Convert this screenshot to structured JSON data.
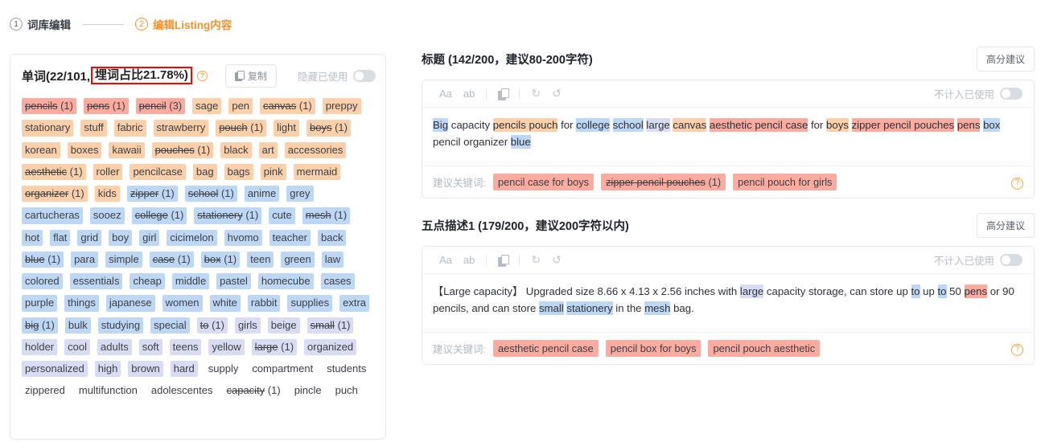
{
  "breadcrumb": {
    "steps": [
      {
        "num": "1",
        "label": "词库编辑",
        "active": false
      },
      {
        "num": "2",
        "label": "编辑Listing内容",
        "active": true
      }
    ]
  },
  "left_panel": {
    "title_prefix": "单词(22/101,",
    "title_boxed": "埋词占比21.78%)",
    "help_icon": "question-circle-icon",
    "copy_label": "复制",
    "copy_icon": "copy-icon",
    "hide_used_label": "隐藏已使用",
    "hide_used_on": false,
    "tags": [
      {
        "w": "pencils",
        "cnt": "(1)",
        "color": "red",
        "used": true
      },
      {
        "w": "pens",
        "cnt": "(1)",
        "color": "red",
        "used": true
      },
      {
        "w": "pencil",
        "cnt": "(3)",
        "color": "red",
        "used": true
      },
      {
        "w": "sage",
        "cnt": "",
        "color": "orange",
        "used": false
      },
      {
        "w": "pen",
        "cnt": "",
        "color": "orange",
        "used": false
      },
      {
        "w": "canvas",
        "cnt": "(1)",
        "color": "orange",
        "used": true
      },
      {
        "w": "preppy",
        "cnt": "",
        "color": "orange",
        "used": false
      },
      {
        "w": "stationary",
        "cnt": "",
        "color": "orange",
        "used": false
      },
      {
        "w": "stuff",
        "cnt": "",
        "color": "orange",
        "used": false
      },
      {
        "w": "fabric",
        "cnt": "",
        "color": "orange",
        "used": false
      },
      {
        "w": "strawberry",
        "cnt": "",
        "color": "orange",
        "used": false
      },
      {
        "w": "pouch",
        "cnt": "(1)",
        "color": "orange",
        "used": true
      },
      {
        "w": "light",
        "cnt": "",
        "color": "orange",
        "used": false
      },
      {
        "w": "boys",
        "cnt": "(1)",
        "color": "orange",
        "used": true
      },
      {
        "w": "korean",
        "cnt": "",
        "color": "orange",
        "used": false
      },
      {
        "w": "boxes",
        "cnt": "",
        "color": "orange",
        "used": false
      },
      {
        "w": "kawaii",
        "cnt": "",
        "color": "orange",
        "used": false
      },
      {
        "w": "pouches",
        "cnt": "(1)",
        "color": "orange",
        "used": true
      },
      {
        "w": "black",
        "cnt": "",
        "color": "orange",
        "used": false
      },
      {
        "w": "art",
        "cnt": "",
        "color": "orange",
        "used": false
      },
      {
        "w": "accessories",
        "cnt": "",
        "color": "orange",
        "used": false
      },
      {
        "w": "aesthetic",
        "cnt": "(1)",
        "color": "orange",
        "used": true
      },
      {
        "w": "roller",
        "cnt": "",
        "color": "orange",
        "used": false
      },
      {
        "w": "pencilcase",
        "cnt": "",
        "color": "orange",
        "used": false
      },
      {
        "w": "bag",
        "cnt": "",
        "color": "orange",
        "used": false
      },
      {
        "w": "bags",
        "cnt": "",
        "color": "orange",
        "used": false
      },
      {
        "w": "pink",
        "cnt": "",
        "color": "orange",
        "used": false
      },
      {
        "w": "mermaid",
        "cnt": "",
        "color": "orange",
        "used": false
      },
      {
        "w": "organizer",
        "cnt": "(1)",
        "color": "orange",
        "used": true
      },
      {
        "w": "kids",
        "cnt": "",
        "color": "orange",
        "used": false
      },
      {
        "w": "zipper",
        "cnt": "(1)",
        "color": "blue",
        "used": true
      },
      {
        "w": "school",
        "cnt": "(1)",
        "color": "blue",
        "used": true
      },
      {
        "w": "anime",
        "cnt": "",
        "color": "blue",
        "used": false
      },
      {
        "w": "grey",
        "cnt": "",
        "color": "blue",
        "used": false
      },
      {
        "w": "cartucheras",
        "cnt": "",
        "color": "blue",
        "used": false
      },
      {
        "w": "sooez",
        "cnt": "",
        "color": "blue",
        "used": false
      },
      {
        "w": "college",
        "cnt": "(1)",
        "color": "blue",
        "used": true
      },
      {
        "w": "stationery",
        "cnt": "(1)",
        "color": "blue",
        "used": true
      },
      {
        "w": "cute",
        "cnt": "",
        "color": "blue",
        "used": false
      },
      {
        "w": "mesh",
        "cnt": "(1)",
        "color": "blue",
        "used": true
      },
      {
        "w": "hot",
        "cnt": "",
        "color": "blue",
        "used": false
      },
      {
        "w": "flat",
        "cnt": "",
        "color": "blue",
        "used": false
      },
      {
        "w": "grid",
        "cnt": "",
        "color": "blue",
        "used": false
      },
      {
        "w": "boy",
        "cnt": "",
        "color": "blue",
        "used": false
      },
      {
        "w": "girl",
        "cnt": "",
        "color": "blue",
        "used": false
      },
      {
        "w": "cicimelon",
        "cnt": "",
        "color": "blue",
        "used": false
      },
      {
        "w": "hvomo",
        "cnt": "",
        "color": "blue",
        "used": false
      },
      {
        "w": "teacher",
        "cnt": "",
        "color": "blue",
        "used": false
      },
      {
        "w": "back",
        "cnt": "",
        "color": "blue",
        "used": false
      },
      {
        "w": "blue",
        "cnt": "(1)",
        "color": "blue",
        "used": true
      },
      {
        "w": "para",
        "cnt": "",
        "color": "blue",
        "used": false
      },
      {
        "w": "simple",
        "cnt": "",
        "color": "blue",
        "used": false
      },
      {
        "w": "case",
        "cnt": "(1)",
        "color": "blue",
        "used": true
      },
      {
        "w": "box",
        "cnt": "(1)",
        "color": "blue",
        "used": true
      },
      {
        "w": "teen",
        "cnt": "",
        "color": "blue",
        "used": false
      },
      {
        "w": "green",
        "cnt": "",
        "color": "blue",
        "used": false
      },
      {
        "w": "law",
        "cnt": "",
        "color": "blue",
        "used": false
      },
      {
        "w": "colored",
        "cnt": "",
        "color": "blue",
        "used": false
      },
      {
        "w": "essentials",
        "cnt": "",
        "color": "blue",
        "used": false
      },
      {
        "w": "cheap",
        "cnt": "",
        "color": "blue",
        "used": false
      },
      {
        "w": "middle",
        "cnt": "",
        "color": "blue",
        "used": false
      },
      {
        "w": "pastel",
        "cnt": "",
        "color": "blue",
        "used": false
      },
      {
        "w": "homecube",
        "cnt": "",
        "color": "blue",
        "used": false
      },
      {
        "w": "cases",
        "cnt": "",
        "color": "blue",
        "used": false
      },
      {
        "w": "purple",
        "cnt": "",
        "color": "blue",
        "used": false
      },
      {
        "w": "things",
        "cnt": "",
        "color": "blue",
        "used": false
      },
      {
        "w": "japanese",
        "cnt": "",
        "color": "blue",
        "used": false
      },
      {
        "w": "women",
        "cnt": "",
        "color": "blue",
        "used": false
      },
      {
        "w": "white",
        "cnt": "",
        "color": "blue",
        "used": false
      },
      {
        "w": "rabbit",
        "cnt": "",
        "color": "blue",
        "used": false
      },
      {
        "w": "supplies",
        "cnt": "",
        "color": "blue",
        "used": false
      },
      {
        "w": "extra",
        "cnt": "",
        "color": "blue",
        "used": false
      },
      {
        "w": "big",
        "cnt": "(1)",
        "color": "blue",
        "used": true
      },
      {
        "w": "bulk",
        "cnt": "",
        "color": "blue",
        "used": false
      },
      {
        "w": "studying",
        "cnt": "",
        "color": "blue",
        "used": false
      },
      {
        "w": "special",
        "cnt": "",
        "color": "blue",
        "used": false
      },
      {
        "w": "to",
        "cnt": "(1)",
        "color": "lav",
        "used": true
      },
      {
        "w": "girls",
        "cnt": "",
        "color": "lav",
        "used": false
      },
      {
        "w": "beige",
        "cnt": "",
        "color": "lav",
        "used": false
      },
      {
        "w": "small",
        "cnt": "(1)",
        "color": "lav",
        "used": true
      },
      {
        "w": "holder",
        "cnt": "",
        "color": "lav",
        "used": false
      },
      {
        "w": "cool",
        "cnt": "",
        "color": "lav",
        "used": false
      },
      {
        "w": "adults",
        "cnt": "",
        "color": "lav",
        "used": false
      },
      {
        "w": "soft",
        "cnt": "",
        "color": "lav",
        "used": false
      },
      {
        "w": "teens",
        "cnt": "",
        "color": "lav",
        "used": false
      },
      {
        "w": "yellow",
        "cnt": "",
        "color": "lav",
        "used": false
      },
      {
        "w": "large",
        "cnt": "(1)",
        "color": "lav",
        "used": true
      },
      {
        "w": "organized",
        "cnt": "",
        "color": "lav",
        "used": false
      },
      {
        "w": "personalized",
        "cnt": "",
        "color": "lav",
        "used": false
      },
      {
        "w": "high",
        "cnt": "",
        "color": "lav",
        "used": false
      },
      {
        "w": "brown",
        "cnt": "",
        "color": "lav",
        "used": false
      },
      {
        "w": "hard",
        "cnt": "",
        "color": "lav",
        "used": false
      },
      {
        "w": "supply",
        "cnt": "",
        "color": "none",
        "used": false
      },
      {
        "w": "compartment",
        "cnt": "",
        "color": "none",
        "used": false
      },
      {
        "w": "students",
        "cnt": "",
        "color": "none",
        "used": false
      },
      {
        "w": "zippered",
        "cnt": "",
        "color": "none",
        "used": false
      },
      {
        "w": "multifunction",
        "cnt": "",
        "color": "none",
        "used": false
      },
      {
        "w": "adolescentes",
        "cnt": "",
        "color": "none",
        "used": false
      },
      {
        "w": "capacity",
        "cnt": "(1)",
        "color": "none",
        "used": true
      },
      {
        "w": "pincle",
        "cnt": "",
        "color": "none",
        "used": false
      },
      {
        "w": "puch",
        "cnt": "",
        "color": "none",
        "used": false
      }
    ]
  },
  "sections": [
    {
      "title": "标题 (142/200，建议80-200字符)",
      "advice_label": "高分建议",
      "toolbar": {
        "case_upper": "Aa",
        "case_lower": "ab",
        "copy_icon": "copy-icon",
        "undo_icon": "undo-icon",
        "redo_icon": "redo-icon",
        "not_counted_label": "不计入已使用",
        "not_counted_on": false
      },
      "content": [
        {
          "t": "Big",
          "hl": "blue"
        },
        {
          "t": " capacity ",
          "hl": ""
        },
        {
          "t": "pencils pouch",
          "hl": "orange"
        },
        {
          "t": " for ",
          "hl": ""
        },
        {
          "t": "college",
          "hl": "blue"
        },
        {
          "t": " ",
          "hl": ""
        },
        {
          "t": "school",
          "hl": "blue"
        },
        {
          "t": " ",
          "hl": ""
        },
        {
          "t": "large",
          "hl": "lav"
        },
        {
          "t": " ",
          "hl": ""
        },
        {
          "t": "canvas",
          "hl": "orange"
        },
        {
          "t": " ",
          "hl": ""
        },
        {
          "t": "aesthetic pencil case",
          "hl": "red"
        },
        {
          "t": " for ",
          "hl": ""
        },
        {
          "t": "boys",
          "hl": "orange"
        },
        {
          "t": " ",
          "hl": ""
        },
        {
          "t": "zipper pencil pouches",
          "hl": "red"
        },
        {
          "t": " ",
          "hl": ""
        },
        {
          "t": "pens",
          "hl": "red"
        },
        {
          "t": " ",
          "hl": ""
        },
        {
          "t": "box",
          "hl": "blue"
        },
        {
          "t": " pencil organizer ",
          "hl": ""
        },
        {
          "t": "blue",
          "hl": "blue"
        }
      ],
      "keywords_label": "建议关键词:",
      "keywords": [
        {
          "t": "pencil case for boys",
          "cnt": "",
          "used": false
        },
        {
          "t": "zipper pencil pouches",
          "cnt": "(1)",
          "used": true
        },
        {
          "t": "pencil pouch for girls",
          "cnt": "",
          "used": false
        }
      ],
      "help_icon": "question-circle-icon"
    },
    {
      "title": "五点描述1 (179/200，建议200字符以内)",
      "advice_label": "高分建议",
      "toolbar": {
        "case_upper": "Aa",
        "case_lower": "ab",
        "copy_icon": "copy-icon",
        "undo_icon": "undo-icon",
        "redo_icon": "redo-icon",
        "not_counted_label": "不计入已使用",
        "not_counted_on": false
      },
      "content": [
        {
          "t": "【Large capacity】 Upgraded size 8.66 x 4.13 x 2.56 inches with ",
          "hl": ""
        },
        {
          "t": "large",
          "hl": "lav"
        },
        {
          "t": " capacity storage, can store up ",
          "hl": ""
        },
        {
          "t": "to",
          "hl": "blue"
        },
        {
          "t": " up ",
          "hl": ""
        },
        {
          "t": "to",
          "hl": "blue"
        },
        {
          "t": " 50 ",
          "hl": ""
        },
        {
          "t": "pens",
          "hl": "red"
        },
        {
          "t": " or 90 pencils, and can store ",
          "hl": ""
        },
        {
          "t": "small",
          "hl": "blue"
        },
        {
          "t": " ",
          "hl": ""
        },
        {
          "t": "stationery",
          "hl": "blue"
        },
        {
          "t": " in the ",
          "hl": ""
        },
        {
          "t": "mesh",
          "hl": "blue"
        },
        {
          "t": " bag.",
          "hl": ""
        }
      ],
      "keywords_label": "建议关键词:",
      "keywords": [
        {
          "t": "aesthetic pencil case",
          "cnt": "",
          "used": false
        },
        {
          "t": "pencil box for boys",
          "cnt": "",
          "used": false
        },
        {
          "t": "pencil pouch aesthetic",
          "cnt": "",
          "used": false
        }
      ],
      "help_icon": "question-circle-icon"
    }
  ],
  "colors": {
    "accent": "#f5922f",
    "tag_red": "#fbaba0",
    "tag_orange": "#fcd0ab",
    "tag_blue": "#bdd7f5",
    "tag_lavender": "#dadcf4",
    "highlight_box": "#ff0000"
  }
}
